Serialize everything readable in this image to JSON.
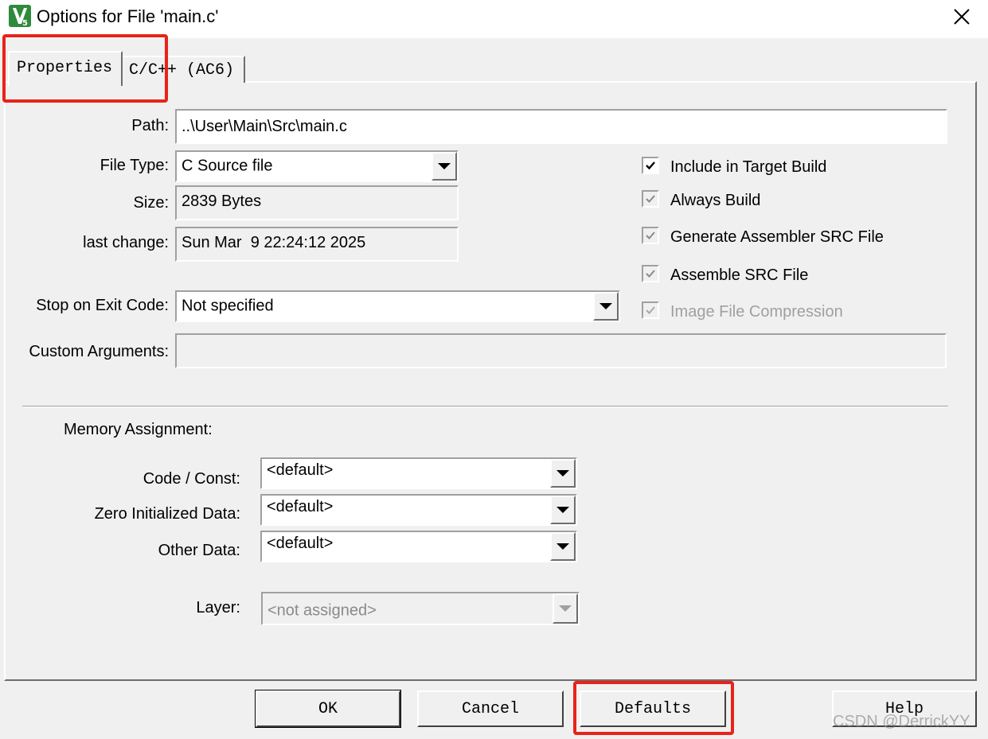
{
  "window": {
    "title": "Options for File 'main.c'"
  },
  "tabs": [
    {
      "label": "Properties",
      "active": true
    },
    {
      "label": "C/C++ (AC6)",
      "active": false
    }
  ],
  "properties": {
    "path": {
      "label": "Path:",
      "value": "..\\User\\Main\\Src\\main.c"
    },
    "file_type": {
      "label": "File Type:",
      "value": "C Source file"
    },
    "size": {
      "label": "Size:",
      "value": "2839 Bytes"
    },
    "last_change": {
      "label": "last change:",
      "value": "Sun Mar  9 22:24:12 2025"
    },
    "stop_on_exit": {
      "label": "Stop on Exit Code:",
      "value": "Not specified"
    },
    "custom_args": {
      "label": "Custom Arguments:",
      "value": ""
    }
  },
  "options": [
    {
      "label": "Include in Target Build",
      "checked": true,
      "enabled": true
    },
    {
      "label": "Always Build",
      "checked": true,
      "enabled": true
    },
    {
      "label": "Generate Assembler SRC File",
      "checked": true,
      "enabled": true
    },
    {
      "label": "Assemble SRC File",
      "checked": true,
      "enabled": true
    },
    {
      "label": "Image File Compression",
      "checked": true,
      "enabled": false
    }
  ],
  "memory": {
    "heading": "Memory Assignment:",
    "code_const": {
      "label": "Code / Const:",
      "value": "<default>"
    },
    "zero_init": {
      "label": "Zero Initialized Data:",
      "value": "<default>"
    },
    "other_data": {
      "label": "Other Data:",
      "value": "<default>"
    },
    "layer": {
      "label": "Layer:",
      "value": "<not assigned>"
    }
  },
  "buttons": {
    "ok": "OK",
    "cancel": "Cancel",
    "defaults": "Defaults",
    "help": "Help"
  },
  "watermark": "CSDN @DerrickYY",
  "colors": {
    "highlight": "#e8231a",
    "app_icon_green": "#2f8a3c"
  },
  "icons": {
    "app": "keil-uvision-icon",
    "close": "close-icon",
    "dropdown": "chevron-down-icon",
    "check": "checkmark-icon"
  }
}
